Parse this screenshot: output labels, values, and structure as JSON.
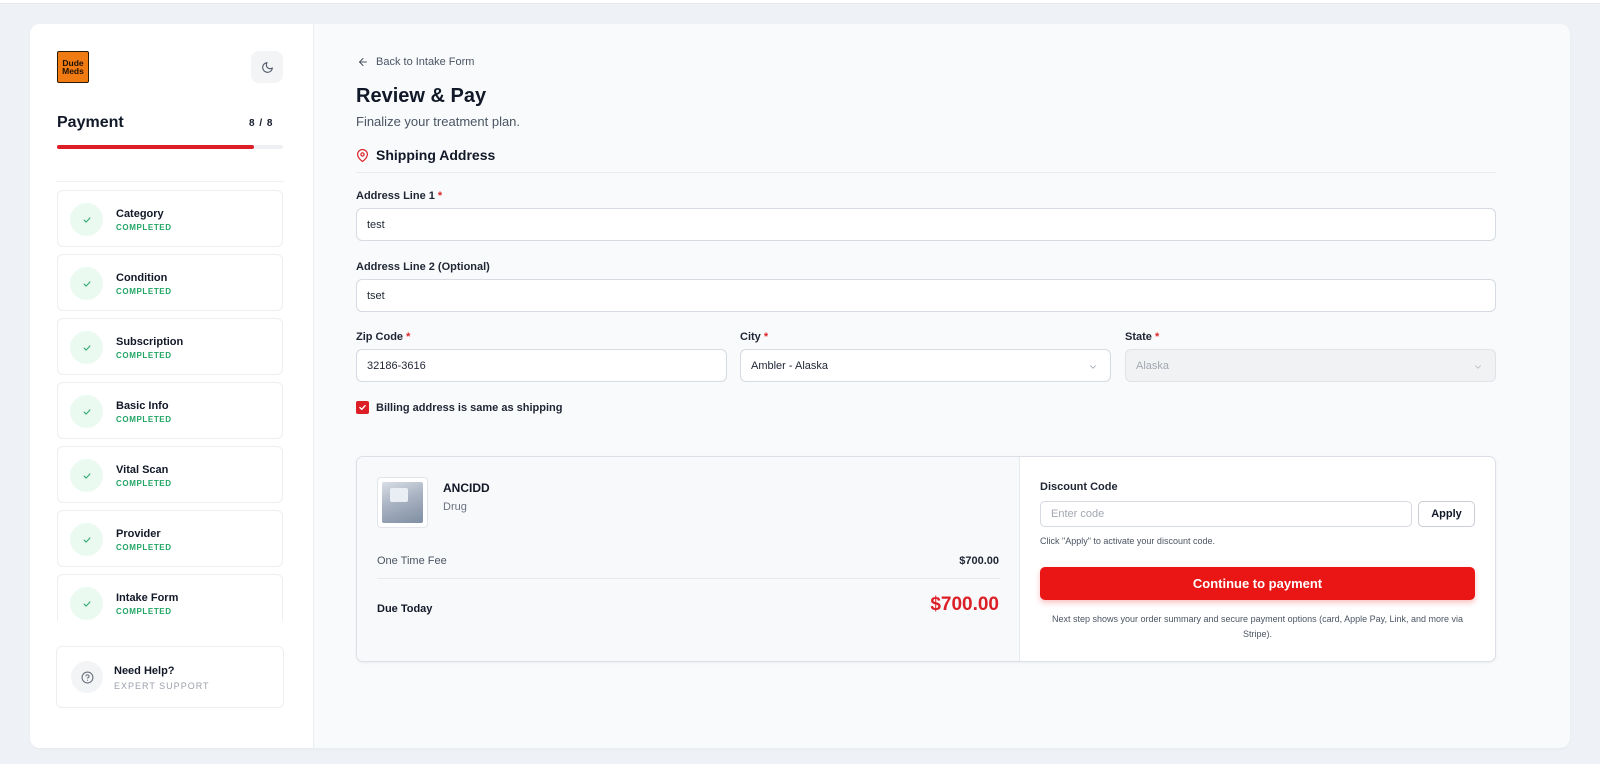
{
  "brand": {
    "logo_line1": "Dude",
    "logo_line2": "Meds",
    "color": "#f07b13"
  },
  "sidebar": {
    "title": "Payment",
    "step_count": "8 / 8",
    "progress_fraction": 0.87,
    "steps": [
      {
        "name": "Category",
        "status": "COMPLETED"
      },
      {
        "name": "Condition",
        "status": "COMPLETED"
      },
      {
        "name": "Subscription",
        "status": "COMPLETED"
      },
      {
        "name": "Basic Info",
        "status": "COMPLETED"
      },
      {
        "name": "Vital Scan",
        "status": "COMPLETED"
      },
      {
        "name": "Provider",
        "status": "COMPLETED"
      },
      {
        "name": "Intake Form",
        "status": "COMPLETED"
      }
    ],
    "help": {
      "title": "Need Help?",
      "subtitle": "EXPERT SUPPORT"
    }
  },
  "header": {
    "back_label": "Back to Intake Form",
    "title": "Review & Pay",
    "subtitle": "Finalize your treatment plan."
  },
  "shipping": {
    "section_title": "Shipping Address",
    "address1": {
      "label": "Address Line 1",
      "required": "*",
      "value": "test"
    },
    "address2": {
      "label": "Address Line 2 (Optional)",
      "value": "tset"
    },
    "zip": {
      "label": "Zip Code",
      "required": "*",
      "value": "32186-3616"
    },
    "city": {
      "label": "City",
      "required": "*",
      "value": "Ambler - Alaska"
    },
    "state": {
      "label": "State",
      "required": "*",
      "value": "Alaska"
    },
    "billing_same_label": "Billing address is same as shipping",
    "billing_same_checked": true
  },
  "order": {
    "product_name": "ANCIDD",
    "product_type": "Drug",
    "fee_label": "One Time Fee",
    "fee_value": "$700.00",
    "due_label": "Due Today",
    "due_value": "$700.00"
  },
  "discount": {
    "label": "Discount Code",
    "placeholder": "Enter code",
    "apply_label": "Apply",
    "hint": "Click \"Apply\" to activate your discount code."
  },
  "payment": {
    "continue_label": "Continue to payment",
    "note": "Next step shows your order summary and secure payment options (card, Apple Pay, Link, and more via Stripe)."
  },
  "colors": {
    "accent": "#dc1f26",
    "success": "#22a565",
    "cta": "#ea1515"
  }
}
